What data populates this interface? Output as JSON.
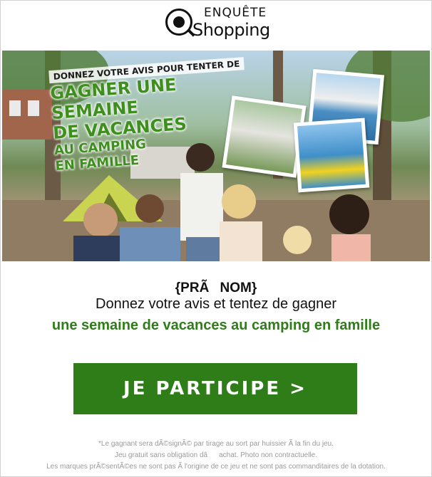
{
  "brand": {
    "line1": "ENQUÊTE",
    "line2": "Shopping"
  },
  "hero": {
    "intro": "DONNEZ VOTRE AVIS POUR TENTER DE",
    "headline_1": "GAGNER UNE SEMAINE",
    "headline_2": "DE VACANCES",
    "headline_3": "AU CAMPING",
    "headline_4": "EN FAMILLE"
  },
  "content": {
    "name_placeholder": "{PRÃNOM}",
    "line1": "Donnez votre avis et tentez de gagner",
    "line2": "une semaine de vacances au camping en famille"
  },
  "cta": {
    "label": "JE PARTICIPE >"
  },
  "legal": {
    "line1": "*Le gagnant sera dÃ©signÃ© par tirage au sort par huissier Ã  la fin du jeu.",
    "line2": "Jeu gratuit sans obligation dâachat. Photo non contractuelle.",
    "line3": "Les marques prÃ©sentÃ©es ne sont pas Ã  l'origine de ce jeu et ne sont pas commanditaires de la dotation."
  },
  "colors": {
    "accent": "#2e7d18",
    "text": "#111111",
    "legal": "#9a9a9a"
  }
}
